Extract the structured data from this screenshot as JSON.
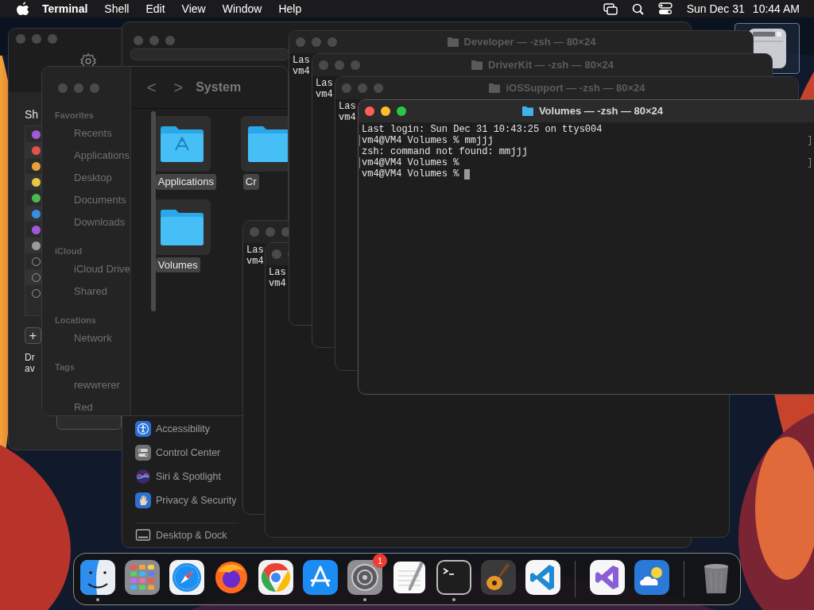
{
  "menu_bar": {
    "app": "Terminal",
    "menus": [
      "Shell",
      "Edit",
      "View",
      "Window",
      "Help"
    ],
    "date": "Sun Dec 31",
    "time": "10:44 AM"
  },
  "back_window": {
    "heading": "Sh",
    "tags": [
      {
        "filled": true,
        "color": "#a259d9"
      },
      {
        "filled": true,
        "color": "#e0544a"
      },
      {
        "filled": true,
        "color": "#e9a23b"
      },
      {
        "filled": true,
        "color": "#e8c846"
      },
      {
        "filled": true,
        "color": "#4cb84f"
      },
      {
        "filled": true,
        "color": "#3a8ee6"
      },
      {
        "filled": true,
        "color": "#a259d9"
      },
      {
        "filled": true,
        "color": "#9a9a9a"
      },
      {
        "filled": false
      },
      {
        "filled": false
      },
      {
        "filled": false
      }
    ],
    "add_label": "+",
    "note_lines": [
      "Dr",
      "av"
    ]
  },
  "settings_window": {
    "sidebar": [
      {
        "kind": "accessibility",
        "label": "Accessibility"
      },
      {
        "kind": "control",
        "label": "Control Center"
      },
      {
        "kind": "siri",
        "label": "Siri & Spotlight"
      },
      {
        "kind": "privacy",
        "label": "Privacy & Security"
      },
      {
        "kind": "desktop",
        "label": "Desktop & Dock"
      }
    ]
  },
  "finder": {
    "title": "System",
    "back": "<",
    "forward": ">",
    "sections": [
      {
        "heading": "Favorites",
        "items": [
          "Recents",
          "Applications",
          "Desktop",
          "Documents",
          "Downloads"
        ]
      },
      {
        "heading": "iCloud",
        "items": [
          "iCloud Drive",
          "Shared"
        ]
      },
      {
        "heading": "Locations",
        "items": [
          "Network"
        ]
      },
      {
        "heading": "Tags",
        "items": [
          "rewwrerer",
          "Red"
        ]
      }
    ],
    "folders": [
      {
        "label": "Applications",
        "kind": "apps",
        "selected": true
      },
      {
        "label": "Cr",
        "kind": "plain",
        "selected": true
      },
      {
        "label": "Volumes",
        "kind": "plain",
        "selected": true
      }
    ]
  },
  "terminals": [
    {
      "active": false,
      "lines": [
        {
          "text": "Las"
        },
        {
          "text": "vm4"
        }
      ]
    },
    {
      "active": false,
      "lines": [
        {
          "text": "Las"
        },
        {
          "text": "vm4"
        }
      ]
    },
    {
      "active": false,
      "title": "Developer — -zsh — 80×24",
      "lines": [
        {
          "text": "Las"
        },
        {
          "text": "vm4"
        }
      ]
    },
    {
      "active": false,
      "title": "DriverKit — -zsh — 80×24",
      "lines": [
        {
          "text": "Las"
        },
        {
          "text": "vm4"
        }
      ]
    },
    {
      "active": false,
      "title": "iOSSupport — -zsh — 80×24",
      "lines": [
        {
          "text": "Las"
        },
        {
          "text": "vm4"
        }
      ]
    },
    {
      "active": true,
      "title": "Volumes — -zsh — 80×24",
      "lines": [
        {
          "text": "Last login: Sun Dec 31 10:43:25 on ttys004",
          "marked": false
        },
        {
          "text": "vm4@VM4 Volumes % mmjjj",
          "marked": true
        },
        {
          "text": "zsh: command not found: mmjjj",
          "marked": false
        },
        {
          "text": "vm4@VM4 Volumes %",
          "marked": true
        },
        {
          "text": "vm4@VM4 Volumes %",
          "marked": false,
          "cursor": true
        }
      ]
    }
  ],
  "dock": [
    {
      "kind": "finder",
      "running": true
    },
    {
      "kind": "launchpad",
      "running": false
    },
    {
      "kind": "safari",
      "running": false
    },
    {
      "kind": "firefox",
      "running": false
    },
    {
      "kind": "chrome",
      "running": false
    },
    {
      "kind": "appstore",
      "running": false
    },
    {
      "kind": "settings",
      "running": true,
      "badge": "1"
    },
    {
      "kind": "textedit",
      "running": false
    },
    {
      "kind": "terminal",
      "running": true
    },
    {
      "kind": "garageband",
      "running": false
    },
    {
      "kind": "vscode",
      "running": false
    },
    {
      "kind": "divider"
    },
    {
      "kind": "vstudio",
      "running": false
    },
    {
      "kind": "weather",
      "running": false
    },
    {
      "kind": "divider"
    },
    {
      "kind": "trash",
      "running": false
    }
  ]
}
